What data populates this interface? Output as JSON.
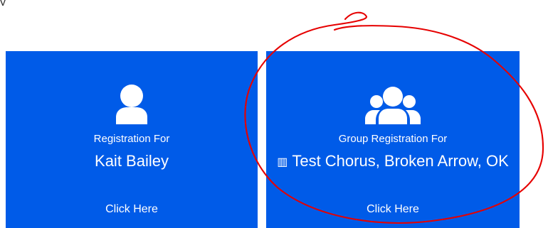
{
  "page": {
    "partial_header_text": "y"
  },
  "cards": [
    {
      "icon": "user-icon",
      "label": "Registration For",
      "name": "Kait Bailey",
      "action": "Click Here"
    },
    {
      "icon": "group-icon",
      "org_icon": "building-icon",
      "label": "Group Registration For",
      "name": "Test Chorus, Broken Arrow, OK",
      "action": "Click Here"
    }
  ],
  "colors": {
    "card_background": "#005be8",
    "card_text": "#ffffff",
    "annotation": "#e60000"
  }
}
